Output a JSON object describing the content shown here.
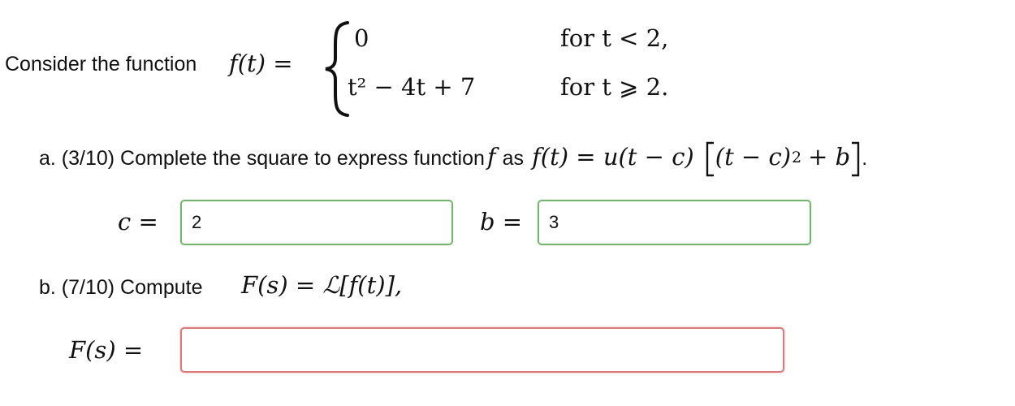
{
  "intro": {
    "label": "Consider the function",
    "lhs": "f(t) =",
    "case1_expr": "0",
    "case1_cond": "for t < 2,",
    "case2_expr": "t² − 4t + 7",
    "case2_cond": "for t ⩾ 2."
  },
  "part_a": {
    "label": "a. (3/10) Complete the square to express function",
    "f_symbol": "f",
    "as_word": "as",
    "formula_left": "f(t) = u(t − c)",
    "formula_inner": "(t − c)",
    "formula_exp": "2",
    "formula_tail": "+ b",
    "end_period": ".",
    "c_label": "c =",
    "c_value": "2",
    "b_label": "b =",
    "b_value": "3"
  },
  "part_b": {
    "label": "b. (7/10) Compute",
    "formula": "F(s) = ℒ[f(t)],",
    "F_label": "F(s) =",
    "F_value": ""
  },
  "colors": {
    "correct_border": "#76b56f",
    "incorrect_border": "#d97a7a"
  }
}
